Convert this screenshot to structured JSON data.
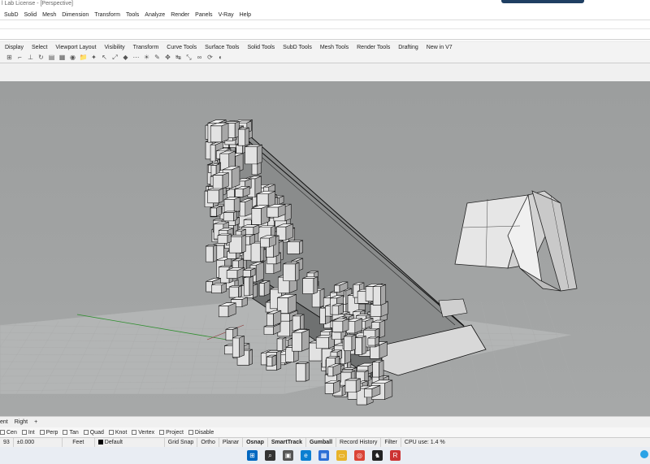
{
  "window": {
    "title": "l Lab License - [Perspective]"
  },
  "menu": {
    "items": [
      "SubD",
      "Solid",
      "Mesh",
      "Dimension",
      "Transform",
      "Tools",
      "Analyze",
      "Render",
      "Panels",
      "V-Ray",
      "Help"
    ]
  },
  "toolbar_tabs": {
    "items": [
      "Display",
      "Select",
      "Viewport Layout",
      "Visibility",
      "Transform",
      "Curve Tools",
      "Surface Tools",
      "Solid Tools",
      "SubD Tools",
      "Mesh Tools",
      "Render Tools",
      "Drafting",
      "New in V7"
    ]
  },
  "toolbar_icons": [
    "grid-snap-icon",
    "bracket-icon",
    "pin-icon",
    "camera-rotate-icon",
    "layer-icon",
    "panel-icon",
    "render-icon",
    "folder-icon",
    "wand-icon",
    "cursor-icon",
    "transform-icon",
    "shape-icon",
    "dots-icon",
    "light-icon",
    "pipette-icon",
    "move-icon",
    "orient-icon",
    "scale-icon",
    "link-icon",
    "rotate-icon",
    "render-display-icon"
  ],
  "viewport_tabs": {
    "items": [
      "ent",
      "Right",
      "+"
    ]
  },
  "osnap": {
    "items": [
      "Cen",
      "Int",
      "Perp",
      "Tan",
      "Quad",
      "Knot",
      "Vertex",
      "Project",
      "Disable"
    ]
  },
  "status": {
    "coord": "93",
    "elevation": "±0.000",
    "units": "Feet",
    "layer": "Default",
    "toggles": [
      {
        "label": "Grid Snap",
        "bold": false
      },
      {
        "label": "Ortho",
        "bold": false
      },
      {
        "label": "Planar",
        "bold": false
      },
      {
        "label": "Osnap",
        "bold": true
      },
      {
        "label": "SmartTrack",
        "bold": true
      },
      {
        "label": "Gumball",
        "bold": true
      },
      {
        "label": "Record History",
        "bold": false
      },
      {
        "label": "Filter",
        "bold": false
      }
    ],
    "cpu": "CPU use: 1.4 %"
  },
  "taskbar": {
    "apps": [
      "windows-start-icon",
      "search-icon",
      "task-view-icon",
      "edge-icon",
      "store-icon",
      "explorer-icon",
      "chrome-icon",
      "app-icon",
      "rhino-icon"
    ]
  },
  "colors": {
    "viewport_bg": "#a0a2a2",
    "model_face": "#e4e4e4",
    "ground": "#b3b5b5"
  }
}
